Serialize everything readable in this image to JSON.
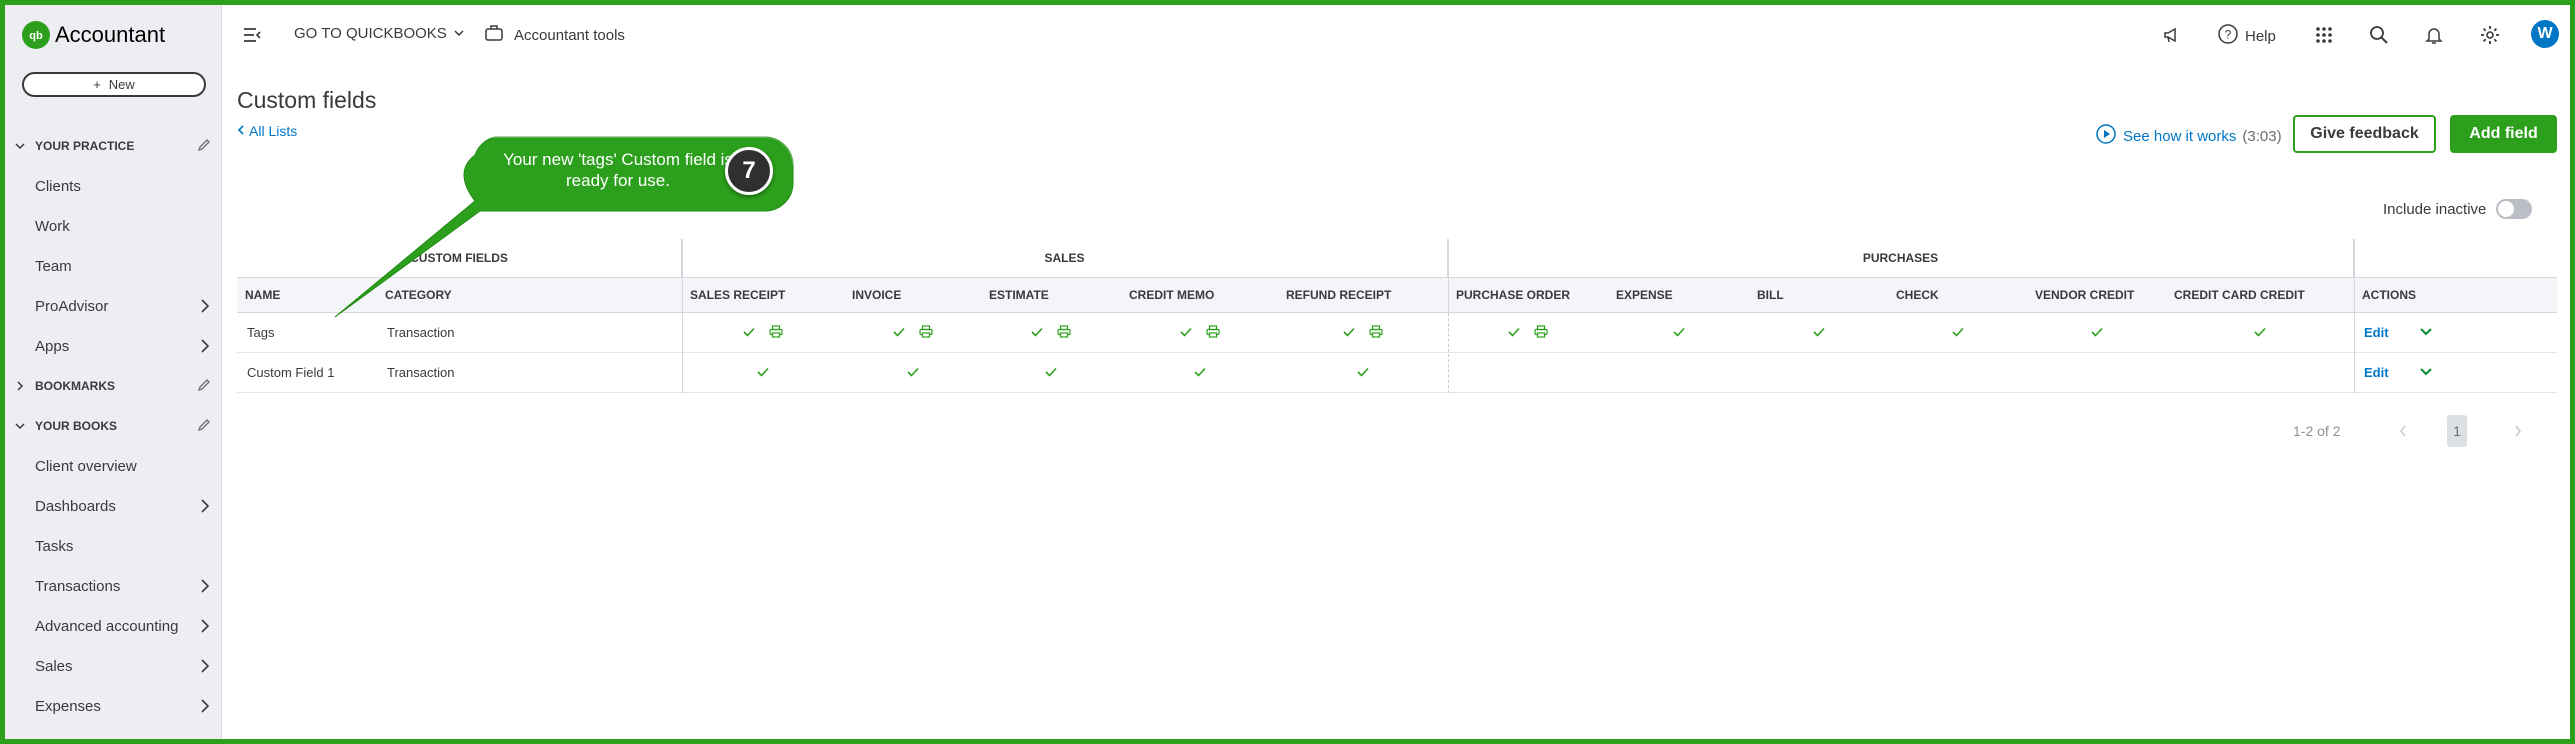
{
  "sidebar": {
    "brand": "Accountant",
    "new_button": "New",
    "sections": [
      {
        "label": "YOUR PRACTICE",
        "expanded": true
      },
      {
        "label": "BOOKMARKS",
        "expanded": false
      },
      {
        "label": "YOUR BOOKS",
        "expanded": true
      }
    ],
    "practice_items": [
      {
        "label": "Clients",
        "has_arrow": false
      },
      {
        "label": "Work",
        "has_arrow": false
      },
      {
        "label": "Team",
        "has_arrow": false
      },
      {
        "label": "ProAdvisor",
        "has_arrow": true
      },
      {
        "label": "Apps",
        "has_arrow": true
      }
    ],
    "books_items": [
      {
        "label": "Client overview",
        "has_arrow": false
      },
      {
        "label": "Dashboards",
        "has_arrow": true
      },
      {
        "label": "Tasks",
        "has_arrow": false
      },
      {
        "label": "Transactions",
        "has_arrow": true
      },
      {
        "label": "Advanced accounting",
        "has_arrow": true
      },
      {
        "label": "Sales",
        "has_arrow": true
      },
      {
        "label": "Expenses",
        "has_arrow": true
      }
    ]
  },
  "topbar": {
    "goto": "GO TO QUICKBOOKS",
    "accountant_tools": "Accountant tools",
    "help": "Help",
    "avatar_initial": "W"
  },
  "page": {
    "title": "Custom fields",
    "back_link": "All Lists",
    "see_how": "See how it works",
    "see_how_duration": "(3:03)",
    "give_feedback": "Give feedback",
    "add_field": "Add field",
    "include_inactive": "Include inactive"
  },
  "table": {
    "groups": {
      "custom_fields": "CUSTOM FIELDS",
      "sales": "SALES",
      "purchases": "PURCHASES"
    },
    "headers": [
      "NAME",
      "CATEGORY",
      "SALES RECEIPT",
      "INVOICE",
      "ESTIMATE",
      "CREDIT MEMO",
      "REFUND RECEIPT",
      "PURCHASE ORDER",
      "EXPENSE",
      "BILL",
      "CHECK",
      "VENDOR CREDIT",
      "CREDIT CARD CREDIT",
      "ACTIONS"
    ],
    "rows": [
      {
        "name": "Tags",
        "category": "Transaction",
        "marks": [
          "check-print",
          "check-print",
          "check-print",
          "check-print",
          "check-print",
          "check-print",
          "check",
          "check",
          "check",
          "check",
          "check"
        ],
        "action": "Edit"
      },
      {
        "name": "Custom Field 1",
        "category": "Transaction",
        "marks": [
          "check",
          "check",
          "check",
          "check",
          "check",
          "",
          "",
          "",
          "",
          "",
          ""
        ],
        "action": "Edit"
      }
    ]
  },
  "pagination": {
    "range": "1-2 of 2",
    "current_page": "1"
  },
  "callout": {
    "text": "Your new 'tags' Custom field is ready for use.",
    "step": "7"
  },
  "colors": {
    "brand_green": "#2ca01c",
    "link_blue": "#0077c5",
    "sidebar_bg": "#eceef1"
  }
}
